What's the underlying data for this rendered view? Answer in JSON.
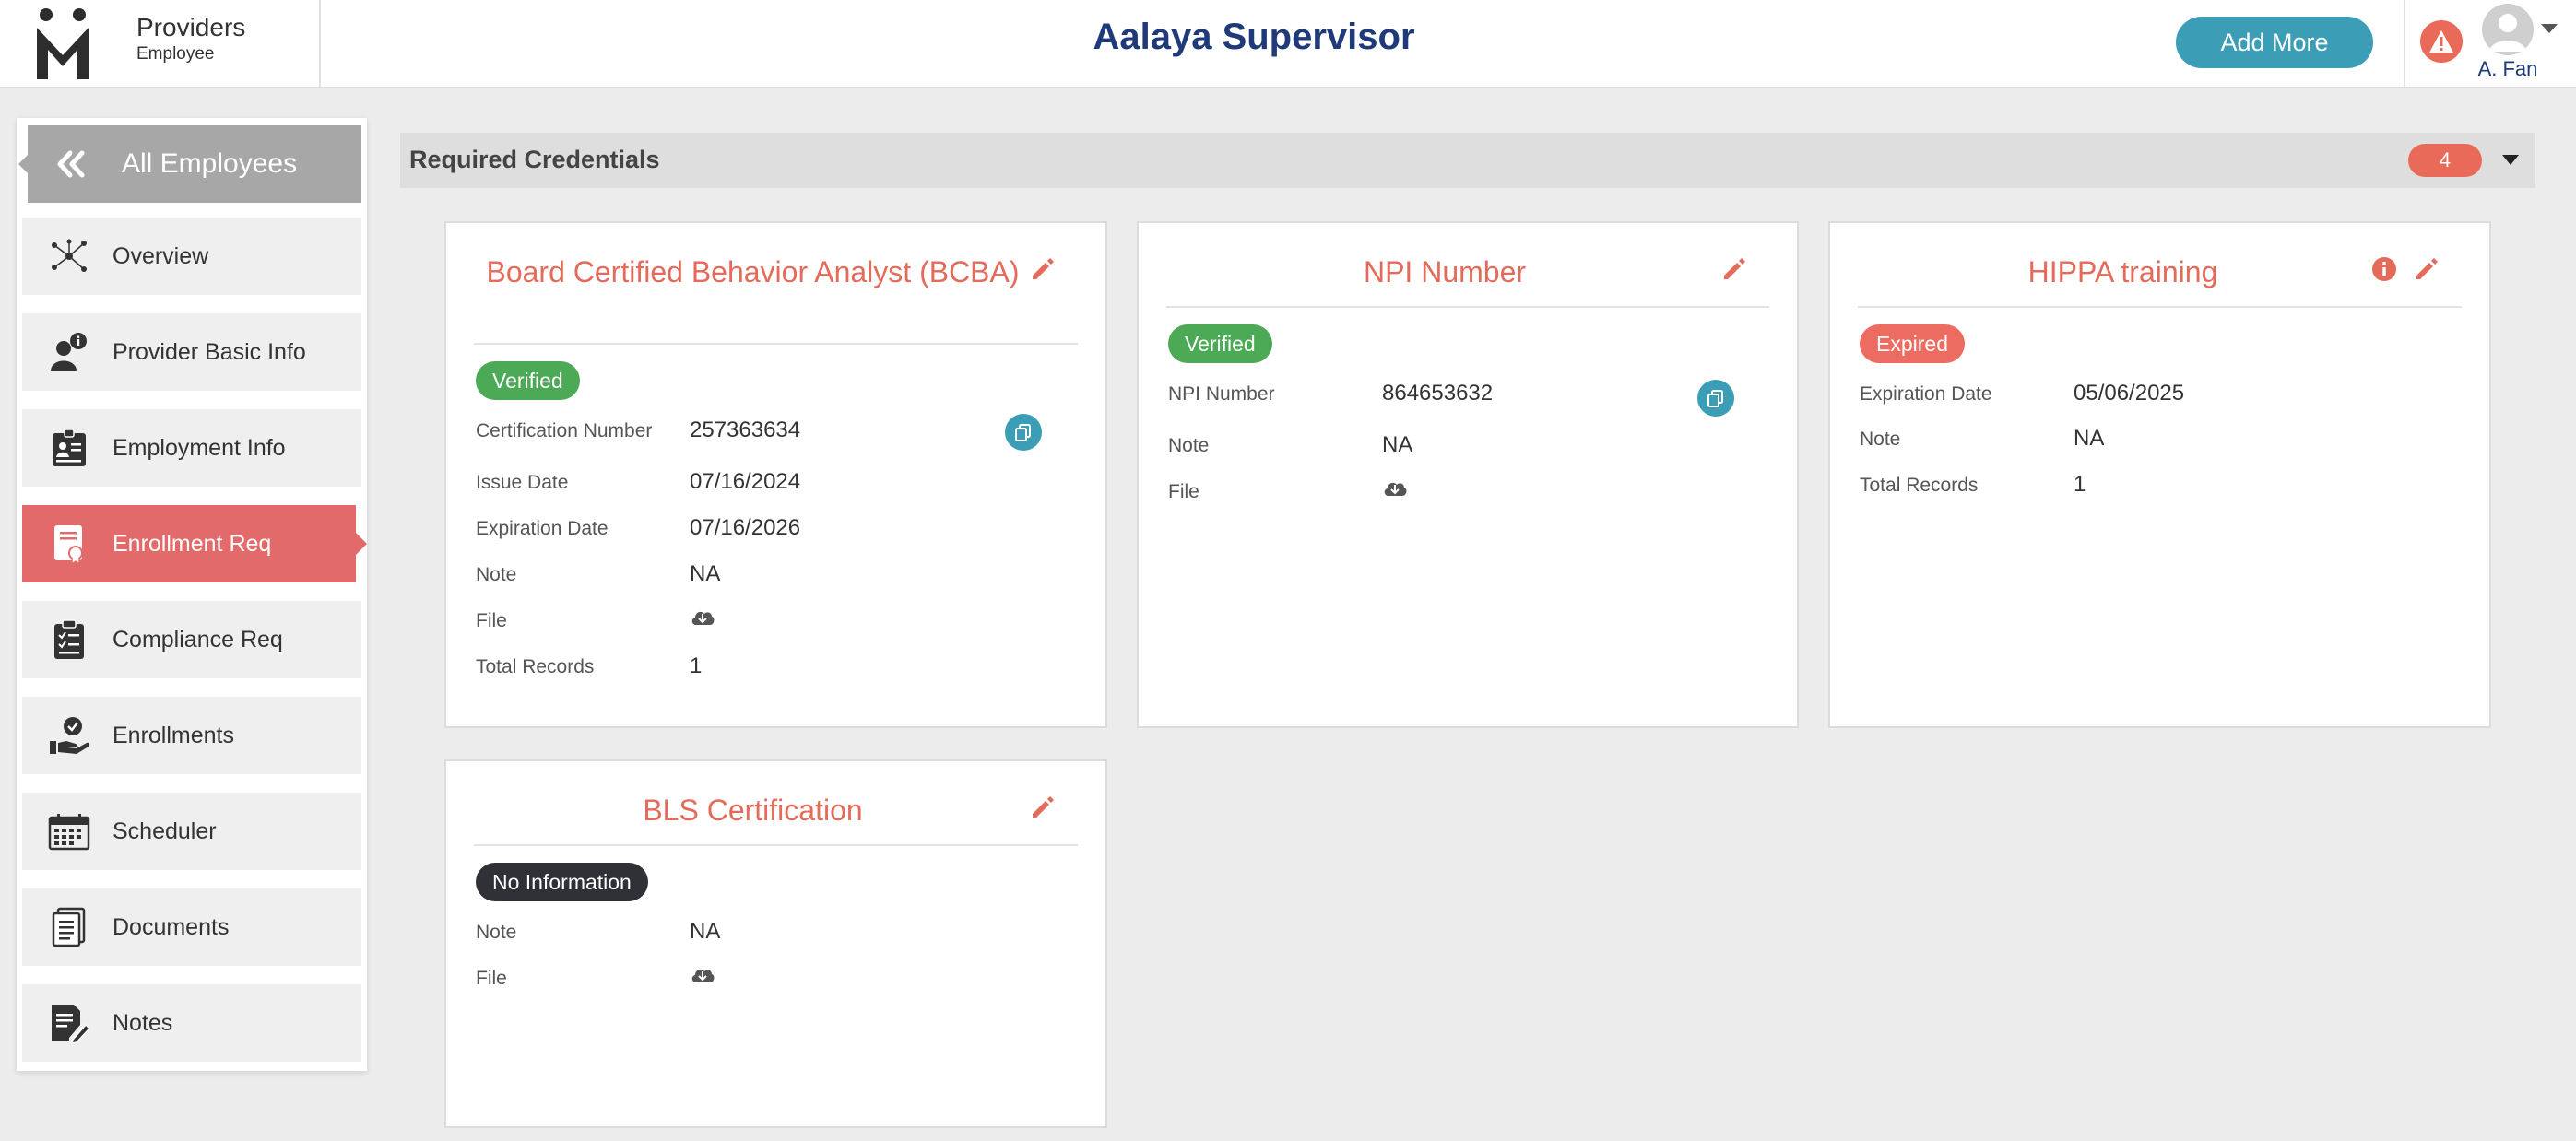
{
  "header": {
    "brand_title": "Providers",
    "brand_sub": "Employee",
    "page_title": "Aalaya Supervisor",
    "add_more": "Add More",
    "user_name": "A. Fan"
  },
  "sidebar": {
    "back_label": "All Employees",
    "items": [
      {
        "label": "Overview",
        "icon": "network-icon"
      },
      {
        "label": "Provider Basic Info",
        "icon": "user-info-icon"
      },
      {
        "label": "Employment Info",
        "icon": "id-badge-icon"
      },
      {
        "label": "Enrollment Req",
        "icon": "certificate-icon",
        "active": true
      },
      {
        "label": "Compliance Req",
        "icon": "checklist-icon"
      },
      {
        "label": "Enrollments",
        "icon": "hand-check-icon"
      },
      {
        "label": "Scheduler",
        "icon": "calendar-icon"
      },
      {
        "label": "Documents",
        "icon": "documents-icon"
      },
      {
        "label": "Notes",
        "icon": "notes-icon"
      }
    ]
  },
  "section": {
    "title": "Required Credentials",
    "count": "4"
  },
  "cards": {
    "bcba": {
      "title": "Board Certified Behavior Analyst (BCBA)",
      "status": "Verified",
      "rows": [
        {
          "label": "Certification Number",
          "value": "257363634"
        },
        {
          "label": "Issue Date",
          "value": "07/16/2024"
        },
        {
          "label": "Expiration Date",
          "value": "07/16/2026"
        },
        {
          "label": "Note",
          "value": "NA"
        },
        {
          "label": "File",
          "value": ""
        },
        {
          "label": "Total Records",
          "value": "1"
        }
      ]
    },
    "npi": {
      "title": "NPI Number",
      "status": "Verified",
      "rows": [
        {
          "label": "NPI Number",
          "value": "864653632"
        },
        {
          "label": "Note",
          "value": "NA"
        },
        {
          "label": "File",
          "value": ""
        }
      ]
    },
    "hippa": {
      "title": "HIPPA training",
      "status": "Expired",
      "rows": [
        {
          "label": "Expiration Date",
          "value": "05/06/2025"
        },
        {
          "label": "Note",
          "value": "NA"
        },
        {
          "label": "Total Records",
          "value": "1"
        }
      ]
    },
    "bls": {
      "title": "BLS Certification",
      "status": "No Information",
      "rows": [
        {
          "label": "Note",
          "value": "NA"
        },
        {
          "label": "File",
          "value": ""
        }
      ]
    }
  },
  "colors": {
    "accent": "#e46a5a",
    "teal": "#3b9eb6",
    "navy": "#1f3a78",
    "verified": "#4caa56",
    "expired": "#ec6c62"
  }
}
